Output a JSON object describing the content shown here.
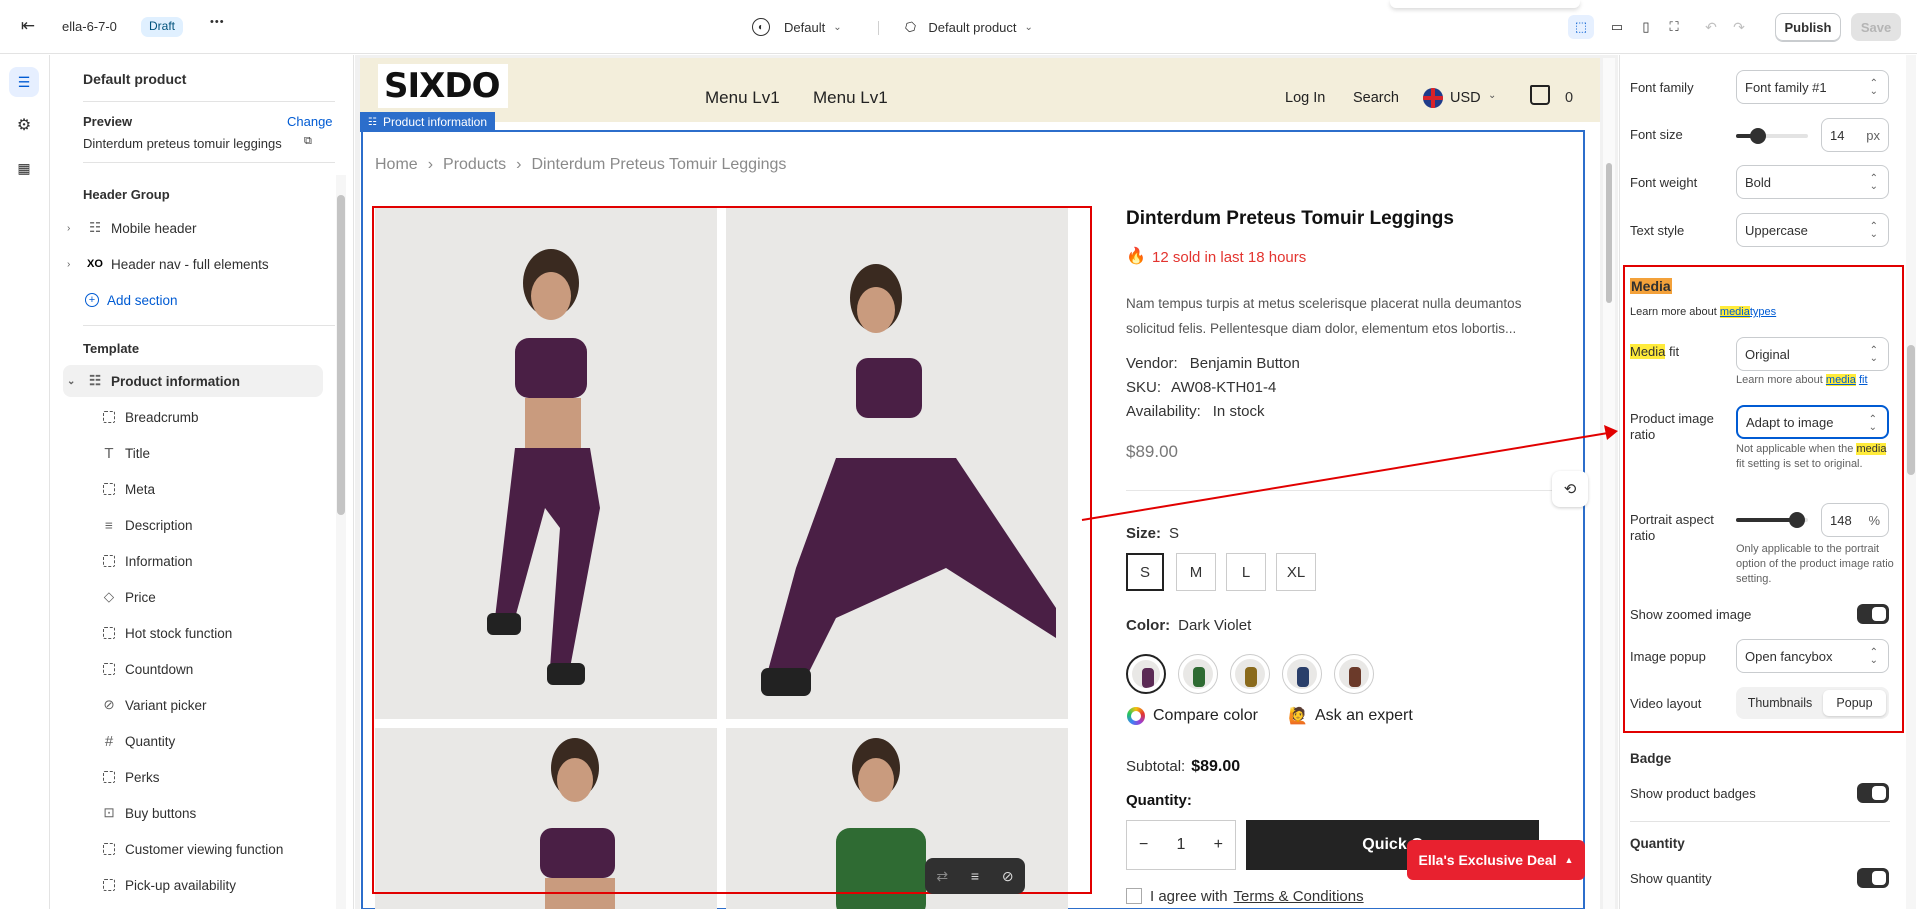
{
  "topbar": {
    "theme_name": "ella-6-7-0",
    "status_badge": "Draft",
    "more_label": "•••",
    "template_selector": "Default",
    "product_selector": "Default product",
    "publish_label": "Publish",
    "save_label": "Save"
  },
  "sidebar": {
    "page_title": "Default product",
    "preview_label": "Preview",
    "change_label": "Change",
    "preview_product": "Dinterdum preteus tomuir leggings",
    "header_group_label": "Header Group",
    "header_items": [
      {
        "label": "Mobile header",
        "icon": "section-icon"
      },
      {
        "label": "Header nav - full elements",
        "icon": "xo-icon"
      }
    ],
    "add_section_label": "Add section",
    "template_label": "Template",
    "section_label": "Product information",
    "blocks": [
      {
        "label": "Breadcrumb",
        "icon": "dashed-box-icon"
      },
      {
        "label": "Title",
        "icon": "text-icon"
      },
      {
        "label": "Meta",
        "icon": "dashed-box-icon"
      },
      {
        "label": "Description",
        "icon": "paragraph-icon"
      },
      {
        "label": "Information",
        "icon": "dashed-box-icon"
      },
      {
        "label": "Price",
        "icon": "price-tag-icon"
      },
      {
        "label": "Hot stock function",
        "icon": "dashed-box-icon"
      },
      {
        "label": "Countdown",
        "icon": "dashed-box-icon"
      },
      {
        "label": "Variant picker",
        "icon": "variant-icon"
      },
      {
        "label": "Quantity",
        "icon": "hash-icon"
      },
      {
        "label": "Perks",
        "icon": "dashed-box-icon"
      },
      {
        "label": "Buy buttons",
        "icon": "cart-icon"
      },
      {
        "label": "Customer viewing function",
        "icon": "dashed-box-icon"
      },
      {
        "label": "Pick-up availability",
        "icon": "dashed-box-icon"
      }
    ]
  },
  "store": {
    "logo": "SIXDO",
    "menu": [
      "Menu Lv1",
      "Menu Lv1"
    ],
    "login": "Log In",
    "search": "Search",
    "currency": "USD",
    "cart_count": "0",
    "section_tag": "Product information",
    "breadcrumb": [
      "Home",
      "Products",
      "Dinterdum Preteus Tomuir Leggings"
    ],
    "product_title": "Dinterdum Preteus Tomuir Leggings",
    "sold_text": "12 sold in last 18 hours",
    "description": "Nam tempus turpis at metus scelerisque placerat nulla deumantos solicitud felis. Pellentesque diam dolor, elementum etos lobortis...",
    "vendor_label": "Vendor:",
    "vendor": "Benjamin Button",
    "sku_label": "SKU:",
    "sku": "AW08-KTH01-4",
    "availability_label": "Availability:",
    "availability": "In stock",
    "price": "$89.00",
    "size_label": "Size:",
    "size_value": "S",
    "sizes": [
      "S",
      "M",
      "L",
      "XL"
    ],
    "color_label": "Color:",
    "color_value": "Dark Violet",
    "swatch_colors": [
      "#5b2a55",
      "#2f6b33",
      "#8a6a1c",
      "#2a3f6a",
      "#6b3a2a"
    ],
    "compare_color": "Compare color",
    "ask_expert": "Ask an expert",
    "subtotal_label": "Subtotal:",
    "subtotal": "$89.00",
    "quantity_label": "Quantity:",
    "quantity": "1",
    "add_button": "Quick C",
    "terms_prefix": "I agree with",
    "terms_link": "Terms & Conditions",
    "deal_label": "Ella's Exclusive Deal"
  },
  "settings": {
    "font_family_label": "Font family",
    "font_family": "Font family #1",
    "font_size_label": "Font size",
    "font_size": "14",
    "font_size_level": 0.3,
    "px": "px",
    "font_weight_label": "Font weight",
    "font_weight": "Bold",
    "text_style_label": "Text style",
    "text_style": "Uppercase",
    "media_heading": "Media",
    "learn_prefix": "Learn more about",
    "learn_link_media": "media",
    "learn_link_types": "types",
    "media_fit_word": "Media",
    "media_fit_rest": " fit",
    "media_fit": "Original",
    "learn_more_fit_prefix": "Learn more about",
    "learn_more_fit_media": "media",
    "learn_more_fit_word": "fit",
    "ratio_label": "Product image ratio",
    "ratio_value": "Adapt to image",
    "ratio_note_1": "Not applicable when the",
    "ratio_note_media": "media",
    "ratio_note_2": "fit setting is set to original.",
    "portrait_label": "Portrait aspect ratio",
    "portrait_value": "148",
    "portrait_level": 0.85,
    "pct": "%",
    "portrait_note": "Only applicable to the portrait option of the product image ratio setting.",
    "zoom_label": "Show zoomed image",
    "popup_label": "Image popup",
    "popup_value": "Open fancybox",
    "video_label": "Video layout",
    "video_opt1": "Thumbnails",
    "video_opt2": "Popup",
    "badge_heading": "Badge",
    "badge_label": "Show product badges",
    "quantity_heading": "Quantity",
    "quantity_label": "Show quantity"
  },
  "colors": {
    "accent": "#005bd3",
    "annotation_red": "#e10000",
    "deal_red": "#e8212f",
    "highlight": "#ffeb3b"
  }
}
